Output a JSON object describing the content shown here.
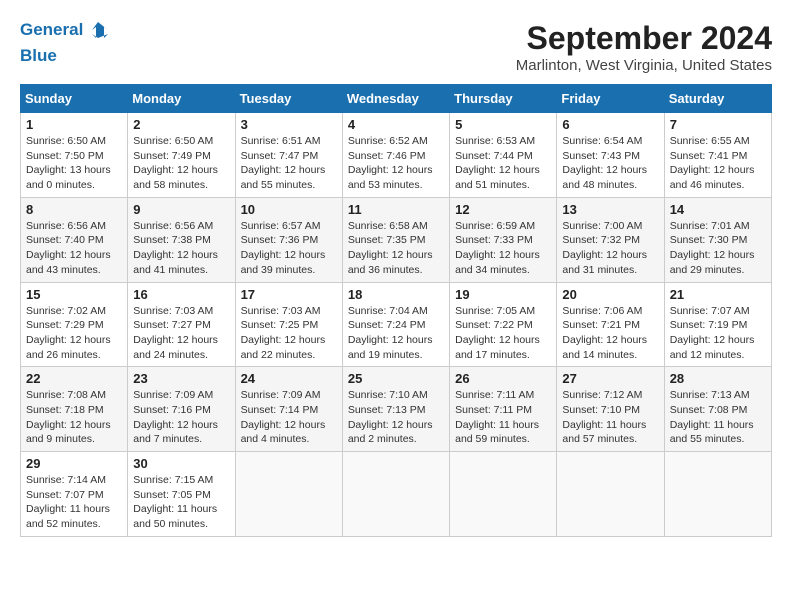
{
  "header": {
    "logo_line1": "General",
    "logo_line2": "Blue",
    "month": "September 2024",
    "location": "Marlinton, West Virginia, United States"
  },
  "days_of_week": [
    "Sunday",
    "Monday",
    "Tuesday",
    "Wednesday",
    "Thursday",
    "Friday",
    "Saturday"
  ],
  "weeks": [
    [
      {
        "day": "1",
        "sunrise": "6:50 AM",
        "sunset": "7:50 PM",
        "daylight": "13 hours and 0 minutes."
      },
      {
        "day": "2",
        "sunrise": "6:50 AM",
        "sunset": "7:49 PM",
        "daylight": "12 hours and 58 minutes."
      },
      {
        "day": "3",
        "sunrise": "6:51 AM",
        "sunset": "7:47 PM",
        "daylight": "12 hours and 55 minutes."
      },
      {
        "day": "4",
        "sunrise": "6:52 AM",
        "sunset": "7:46 PM",
        "daylight": "12 hours and 53 minutes."
      },
      {
        "day": "5",
        "sunrise": "6:53 AM",
        "sunset": "7:44 PM",
        "daylight": "12 hours and 51 minutes."
      },
      {
        "day": "6",
        "sunrise": "6:54 AM",
        "sunset": "7:43 PM",
        "daylight": "12 hours and 48 minutes."
      },
      {
        "day": "7",
        "sunrise": "6:55 AM",
        "sunset": "7:41 PM",
        "daylight": "12 hours and 46 minutes."
      }
    ],
    [
      {
        "day": "8",
        "sunrise": "6:56 AM",
        "sunset": "7:40 PM",
        "daylight": "12 hours and 43 minutes."
      },
      {
        "day": "9",
        "sunrise": "6:56 AM",
        "sunset": "7:38 PM",
        "daylight": "12 hours and 41 minutes."
      },
      {
        "day": "10",
        "sunrise": "6:57 AM",
        "sunset": "7:36 PM",
        "daylight": "12 hours and 39 minutes."
      },
      {
        "day": "11",
        "sunrise": "6:58 AM",
        "sunset": "7:35 PM",
        "daylight": "12 hours and 36 minutes."
      },
      {
        "day": "12",
        "sunrise": "6:59 AM",
        "sunset": "7:33 PM",
        "daylight": "12 hours and 34 minutes."
      },
      {
        "day": "13",
        "sunrise": "7:00 AM",
        "sunset": "7:32 PM",
        "daylight": "12 hours and 31 minutes."
      },
      {
        "day": "14",
        "sunrise": "7:01 AM",
        "sunset": "7:30 PM",
        "daylight": "12 hours and 29 minutes."
      }
    ],
    [
      {
        "day": "15",
        "sunrise": "7:02 AM",
        "sunset": "7:29 PM",
        "daylight": "12 hours and 26 minutes."
      },
      {
        "day": "16",
        "sunrise": "7:03 AM",
        "sunset": "7:27 PM",
        "daylight": "12 hours and 24 minutes."
      },
      {
        "day": "17",
        "sunrise": "7:03 AM",
        "sunset": "7:25 PM",
        "daylight": "12 hours and 22 minutes."
      },
      {
        "day": "18",
        "sunrise": "7:04 AM",
        "sunset": "7:24 PM",
        "daylight": "12 hours and 19 minutes."
      },
      {
        "day": "19",
        "sunrise": "7:05 AM",
        "sunset": "7:22 PM",
        "daylight": "12 hours and 17 minutes."
      },
      {
        "day": "20",
        "sunrise": "7:06 AM",
        "sunset": "7:21 PM",
        "daylight": "12 hours and 14 minutes."
      },
      {
        "day": "21",
        "sunrise": "7:07 AM",
        "sunset": "7:19 PM",
        "daylight": "12 hours and 12 minutes."
      }
    ],
    [
      {
        "day": "22",
        "sunrise": "7:08 AM",
        "sunset": "7:18 PM",
        "daylight": "12 hours and 9 minutes."
      },
      {
        "day": "23",
        "sunrise": "7:09 AM",
        "sunset": "7:16 PM",
        "daylight": "12 hours and 7 minutes."
      },
      {
        "day": "24",
        "sunrise": "7:09 AM",
        "sunset": "7:14 PM",
        "daylight": "12 hours and 4 minutes."
      },
      {
        "day": "25",
        "sunrise": "7:10 AM",
        "sunset": "7:13 PM",
        "daylight": "12 hours and 2 minutes."
      },
      {
        "day": "26",
        "sunrise": "7:11 AM",
        "sunset": "7:11 PM",
        "daylight": "11 hours and 59 minutes."
      },
      {
        "day": "27",
        "sunrise": "7:12 AM",
        "sunset": "7:10 PM",
        "daylight": "11 hours and 57 minutes."
      },
      {
        "day": "28",
        "sunrise": "7:13 AM",
        "sunset": "7:08 PM",
        "daylight": "11 hours and 55 minutes."
      }
    ],
    [
      {
        "day": "29",
        "sunrise": "7:14 AM",
        "sunset": "7:07 PM",
        "daylight": "11 hours and 52 minutes."
      },
      {
        "day": "30",
        "sunrise": "7:15 AM",
        "sunset": "7:05 PM",
        "daylight": "11 hours and 50 minutes."
      },
      null,
      null,
      null,
      null,
      null
    ]
  ]
}
